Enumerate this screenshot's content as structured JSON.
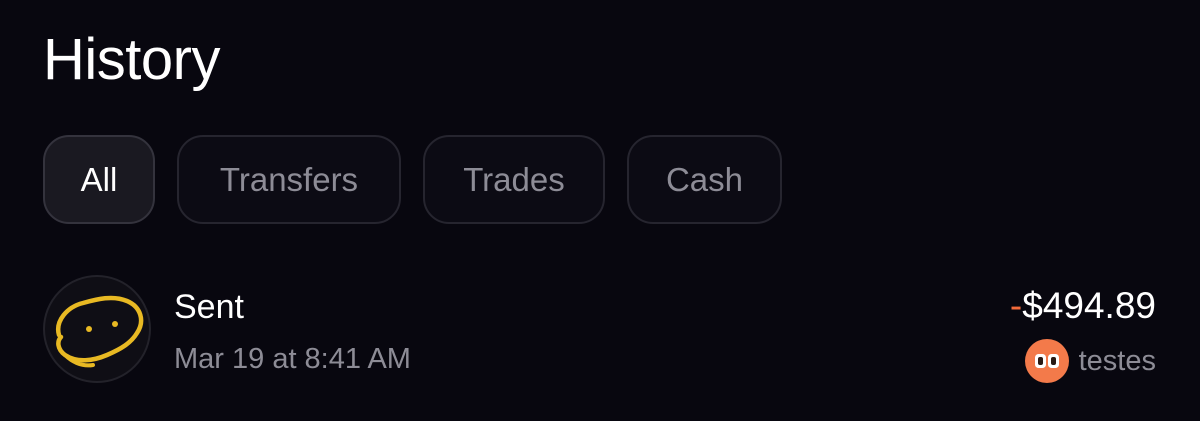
{
  "header": {
    "title": "History"
  },
  "filters": {
    "tabs": [
      {
        "label": "All",
        "active": true
      },
      {
        "label": "Transfers",
        "active": false
      },
      {
        "label": "Trades",
        "active": false
      },
      {
        "label": "Cash",
        "active": false
      }
    ]
  },
  "transactions": [
    {
      "title": "Sent",
      "date": "Mar 19 at 8:41 AM",
      "amount_sign": "-",
      "amount": "$494.89",
      "recipient": "testes",
      "avatar_icon": "doodle-face-icon",
      "recipient_icon": "token-icon"
    }
  ],
  "colors": {
    "background": "#08070f",
    "accent_negative": "#f36a3a",
    "token_orange": "#f37a4a",
    "doodle_yellow": "#e8b923",
    "muted_text": "#8d8c96"
  }
}
